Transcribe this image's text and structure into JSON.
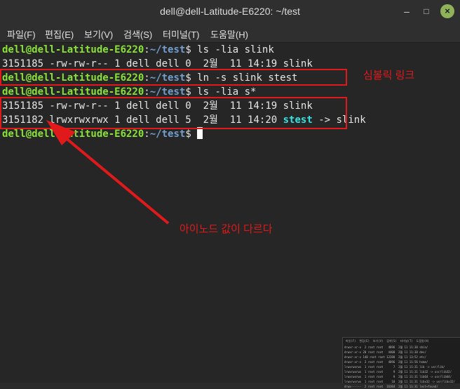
{
  "window": {
    "title": "dell@dell-Latitude-E6220: ~/test"
  },
  "controls": {
    "minimize": "–",
    "maximize": "□",
    "close": "×"
  },
  "menu": [
    "파일(F)",
    "편집(E)",
    "보기(V)",
    "검색(S)",
    "터미널(T)",
    "도움말(H)"
  ],
  "prompt": {
    "user": "dell@dell-Latitude-E6220",
    "colon": ":",
    "path": "~/test",
    "dollar": "$"
  },
  "lines": {
    "cmd1": " ls -lia slink",
    "out1": "3151185 -rw-rw-r-- 1 dell dell 0  2월  11 14:19 slink",
    "cmd2": " ln -s slink stest",
    "cmd3": " ls -lia s*",
    "out2": "3151185 -rw-rw-r-- 1 dell dell 0  2월  11 14:19 slink",
    "out3_prefix": "3151182 lrwxrwxrwx 1 dell dell 5  2월  11 14:20 ",
    "out3_link": "stest",
    "out3_suffix": " -> slink"
  },
  "annotations": {
    "symlink_label": "심볼릭 링크",
    "inode_label": "아이노드 값이 다르다"
  },
  "thumbnail": {
    "menu": "파일(F)  편집(E)  보기(V)  검색(S)  터미널(T)  도움말(H)",
    "lines": [
      "drwxr-xr-x  2 root root   4096  2월 11 11:38 sbin/",
      "drwxr-xr-x 20 root root   4400  2월 11 11:38 dev/",
      "drwxr-xr-x 140 root root 12288  2월 11 13:52 etc/",
      "drwxr-xr-x  3 root root   4096  2월 11 11:56 home/",
      "lrwxrwxrwx  1 root root      7  2월 11 11:31 lib -> usr/lib/",
      "lrwxrwxrwx  1 root root      9  2월 11 11:31 lib32 -> usr/lib32/",
      "lrwxrwxrwx  1 root root      9  2월 11 11:31 lib64 -> usr/lib64/",
      "lrwxrwxrwx  1 root root     10  2월 11 11:31 libx32 -> usr/libx32/",
      "drwx------  2 root root  16384  2월 11 11:31 lost+found/"
    ]
  },
  "colors": {
    "annotation": "#e0191b",
    "prompt_user": "#8ae234",
    "prompt_path": "#729fcf",
    "symlink": "#34e2e2"
  }
}
